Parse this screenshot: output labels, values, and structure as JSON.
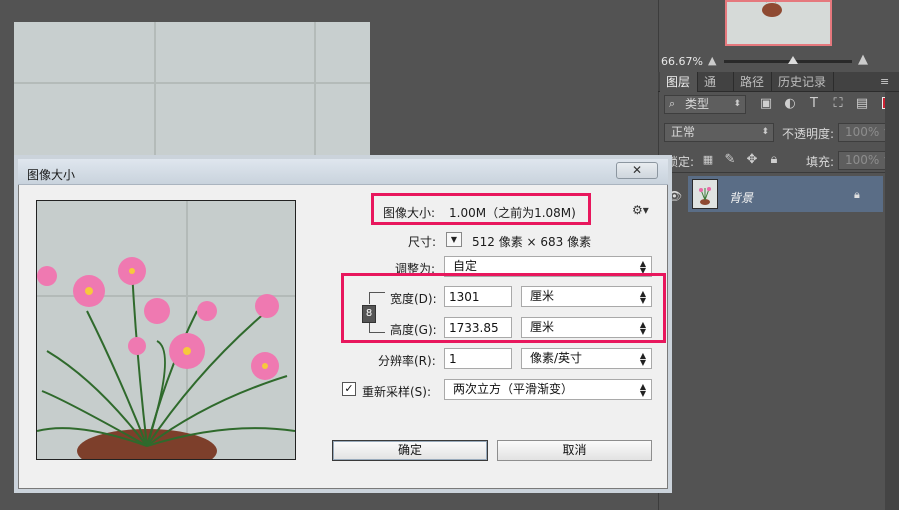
{
  "panels": {
    "zoom_level": "66.67%",
    "tabs": [
      {
        "label": "图层",
        "active": true
      },
      {
        "label": "通道",
        "active": false
      },
      {
        "label": "路径",
        "active": false
      },
      {
        "label": "历史记录",
        "active": false
      }
    ],
    "filter_kind": "类型",
    "blend_mode": "正常",
    "opacity_label": "不透明度:",
    "opacity_value": "100%",
    "lock_label": "锁定:",
    "fill_label": "填充:",
    "fill_value": "100%",
    "layer_name": "背景"
  },
  "dialog": {
    "title": "图像大小",
    "close_symbol": "✕",
    "image_size_label": "图像大小:",
    "image_size_value": "1.00M（之前为1.08M)",
    "dimensions_label": "尺寸:",
    "dimensions_value": "512 像素 × 683 像素",
    "fit_to_label": "调整为:",
    "fit_to_value": "自定",
    "width_label": "宽度(D):",
    "width_value": "1301",
    "width_unit": "厘米",
    "height_label": "高度(G):",
    "height_value": "1733.85",
    "height_unit": "厘米",
    "resolution_label": "分辨率(R):",
    "resolution_value": "1",
    "resolution_unit": "像素/英寸",
    "resample_label": "重新采样(S):",
    "resample_checked": true,
    "resample_value": "两次立方（平滑渐变）",
    "ok_label": "确定",
    "cancel_label": "取消"
  },
  "colors": {
    "highlight": "#e8175d",
    "layer_selected": "#5a6d86"
  }
}
